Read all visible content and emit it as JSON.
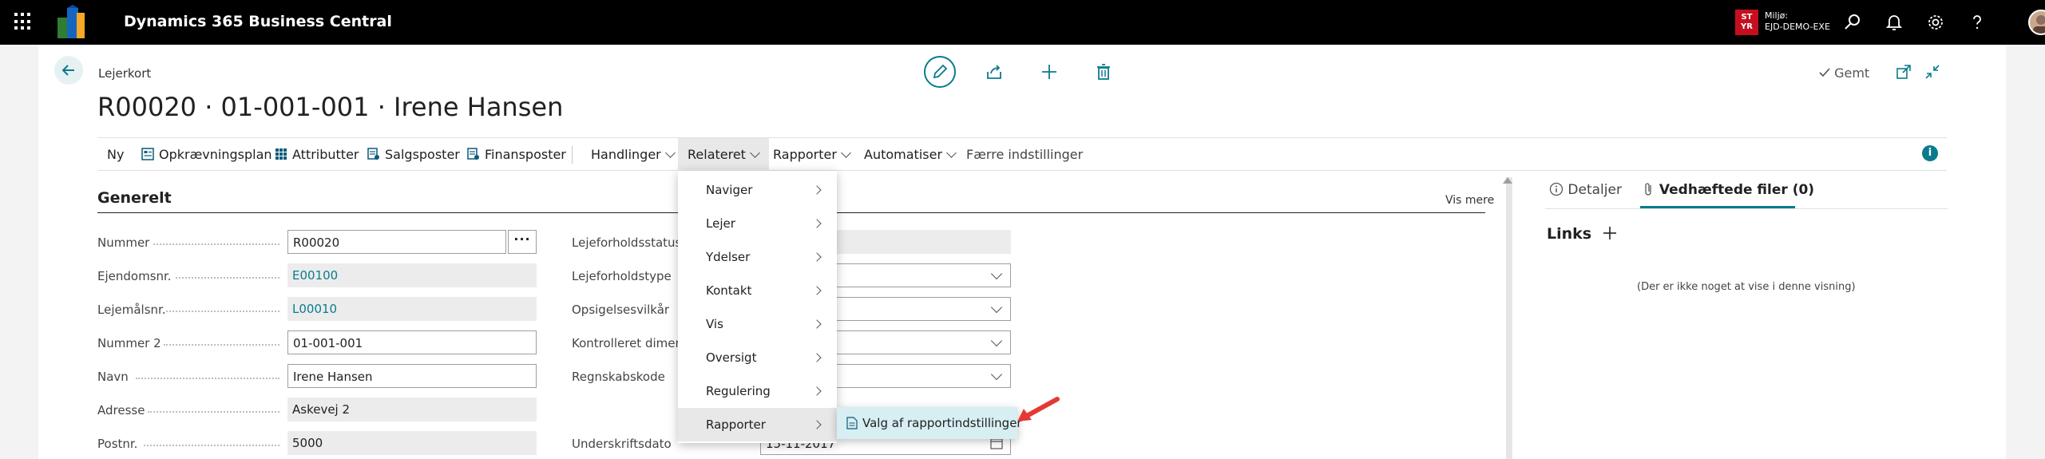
{
  "topbar": {
    "app_title": "Dynamics 365 Business Central",
    "environment_badge": "ST\nYR",
    "environment_label": "Miljø:",
    "environment_name": "EJD-DEMO-EXE"
  },
  "header": {
    "breadcrumb": "Lejerkort",
    "title": "R00020 · 01-001-001 · Irene Hansen",
    "saved_label": "Gemt"
  },
  "actionbar": {
    "items": [
      {
        "label": "Ny",
        "icon": "none",
        "dropdown": false
      },
      {
        "label": "Opkrævningsplan",
        "icon": "plan-icon",
        "dropdown": false
      },
      {
        "label": "Attributter",
        "icon": "grid-icon",
        "dropdown": false
      },
      {
        "label": "Salgsposter",
        "icon": "ledger-icon",
        "dropdown": false
      },
      {
        "label": "Finansposter",
        "icon": "ledger-icon",
        "dropdown": false
      },
      {
        "label": "Handlinger",
        "icon": "none",
        "dropdown": true
      },
      {
        "label": "Relateret",
        "icon": "none",
        "dropdown": true,
        "active": true
      },
      {
        "label": "Rapporter",
        "icon": "none",
        "dropdown": true
      },
      {
        "label": "Automatiser",
        "icon": "none",
        "dropdown": true
      },
      {
        "label": "Færre indstillinger",
        "icon": "none",
        "dropdown": false
      }
    ]
  },
  "general": {
    "title": "Generelt",
    "show_more": "Vis mere",
    "left_fields": [
      {
        "label": "Nummer",
        "value": "R00020",
        "kind": "edit"
      },
      {
        "label": "Ejendomsnr.",
        "value": "E00100",
        "kind": "link"
      },
      {
        "label": "Lejemålsnr.",
        "value": "L00010",
        "kind": "link"
      },
      {
        "label": "Nummer 2",
        "value": "01-001-001",
        "kind": "edit"
      },
      {
        "label": "Navn",
        "value": "Irene Hansen",
        "kind": "edit"
      },
      {
        "label": "Adresse",
        "value": "Askevej 2",
        "kind": "ro"
      },
      {
        "label": "Postnr.",
        "value": "5000",
        "kind": "ro"
      }
    ],
    "right_fields": [
      {
        "label": "Lejeforholdsstatus",
        "value": "",
        "kind": "ro"
      },
      {
        "label": "Lejeforholdstype",
        "value": "",
        "kind": "select"
      },
      {
        "label": "Opsigelsesvilkår",
        "value": "",
        "kind": "select"
      },
      {
        "label": "Kontrolleret dimens",
        "value": "",
        "kind": "select"
      },
      {
        "label": "Regnskabskode",
        "value": "",
        "kind": "select"
      },
      {
        "label": "Underskriftsdato",
        "value": "15-11-2017",
        "kind": "date"
      }
    ]
  },
  "right_panel": {
    "tabs": [
      {
        "label": "Detaljer",
        "active": false
      },
      {
        "label": "Vedhæftede filer (0)",
        "active": true
      }
    ],
    "links_title": "Links",
    "links_empty": "(Der er ikke noget at vise i denne visning)"
  },
  "menu": {
    "items": [
      "Naviger",
      "Lejer",
      "Ydelser",
      "Kontakt",
      "Vis",
      "Oversigt",
      "Regulering",
      "Rapporter"
    ],
    "highlighted_index": 7,
    "submenu_item": "Valg af rapportindstillinger"
  },
  "colors": {
    "accent": "#0a7b8c",
    "topbar": "#000000",
    "badge": "#c50f1f",
    "annotation_arrow": "#e53935"
  }
}
